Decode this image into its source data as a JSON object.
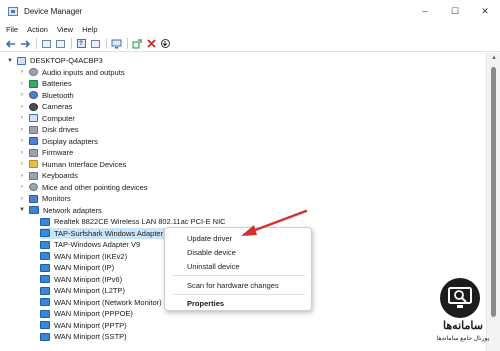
{
  "window": {
    "title": "Device Manager",
    "controls": {
      "minimize": "–",
      "maximize": "☐",
      "close": "✕"
    }
  },
  "menu": [
    "File",
    "Action",
    "View",
    "Help"
  ],
  "toolbar": {
    "icons": [
      "back-arrow-icon",
      "forward-arrow-icon",
      "properties-icon",
      "show-hidden-icon",
      "help-icon",
      "view-resources-icon",
      "monitor-icon",
      "update-driver-icon",
      "uninstall-icon",
      "scan-icon"
    ]
  },
  "tree": {
    "root": "DESKTOP-Q4ACBP3",
    "categories": [
      {
        "label": "Audio inputs and outputs",
        "icon": "speaker-icon"
      },
      {
        "label": "Batteries",
        "icon": "battery-icon"
      },
      {
        "label": "Bluetooth",
        "icon": "bluetooth-icon"
      },
      {
        "label": "Cameras",
        "icon": "camera-icon"
      },
      {
        "label": "Computer",
        "icon": "computer-icon"
      },
      {
        "label": "Disk drives",
        "icon": "disk-drive-icon"
      },
      {
        "label": "Display adapters",
        "icon": "display-adapter-icon"
      },
      {
        "label": "Firmware",
        "icon": "firmware-icon"
      },
      {
        "label": "Human Interface Devices",
        "icon": "hid-icon"
      },
      {
        "label": "Keyboards",
        "icon": "keyboard-icon"
      },
      {
        "label": "Mice and other pointing devices",
        "icon": "mouse-icon"
      },
      {
        "label": "Monitors",
        "icon": "monitor-icon"
      },
      {
        "label": "Network adapters",
        "icon": "network-adapter-icon"
      }
    ],
    "network_adapters": [
      "Realtek 8822CE Wireless LAN 802.11ac PCI-E NIC",
      "TAP-Surfshark Windows Adapter V9",
      "TAP-Windows Adapter V9",
      "WAN Miniport (IKEv2)",
      "WAN Miniport (IP)",
      "WAN Miniport (IPv6)",
      "WAN Miniport (L2TP)",
      "WAN Miniport (Network Monitor)",
      "WAN Miniport (PPPOE)",
      "WAN Miniport (PPTP)",
      "WAN Miniport (SSTP)"
    ],
    "selected": "TAP-Surfshark Windows Adapter V9"
  },
  "context_menu": {
    "update_driver": "Update driver",
    "disable_device": "Disable device",
    "uninstall_device": "Uninstall device",
    "scan_changes": "Scan for hardware changes",
    "properties": "Properties"
  },
  "watermark": {
    "title": "سامانه‌ها",
    "subtitle": "پورتال جامع سامانه‌ها"
  },
  "colors": {
    "accent_red": "#d32f2f",
    "selection": "#cce4f7",
    "network_icon": "#3a86d8"
  }
}
